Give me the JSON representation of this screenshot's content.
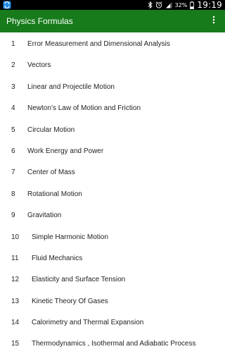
{
  "status_bar": {
    "battery": "32%",
    "time": "19:19"
  },
  "app_bar": {
    "title": "Physics Formulas",
    "overflow_icon": "more-vert-icon"
  },
  "topics": [
    {
      "num": "1",
      "title": "Error Measurement and Dimensional Analysis"
    },
    {
      "num": "2",
      "title": "Vectors"
    },
    {
      "num": "3",
      "title": "Linear and Projectile Motion"
    },
    {
      "num": "4",
      "title": "Newton’s Law of Motion and Friction"
    },
    {
      "num": "5",
      "title": "Circular Motion"
    },
    {
      "num": "6",
      "title": "Work Energy and Power"
    },
    {
      "num": "7",
      "title": "Center of Mass"
    },
    {
      "num": "8",
      "title": "Rotational Motion"
    },
    {
      "num": "9",
      "title": "Gravitation"
    },
    {
      "num": "10",
      "title": "Simple Harmonic Motion"
    },
    {
      "num": "11",
      "title": "Fluid Mechanics"
    },
    {
      "num": "12",
      "title": "Elasticity and Surface Tension"
    },
    {
      "num": "13",
      "title": "Kinetic Theory Of Gases"
    },
    {
      "num": "14",
      "title": "Calorimetry and Thermal Expansion"
    },
    {
      "num": "15",
      "title": "Thermodynamics , Isothermal and Adiabatic Process"
    }
  ],
  "colors": {
    "app_bar": "#177b1b",
    "status_bar": "#000000",
    "text": "#222222"
  }
}
